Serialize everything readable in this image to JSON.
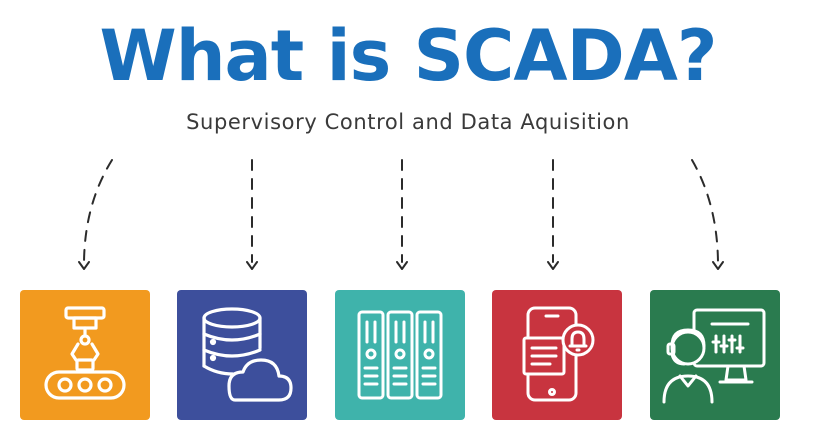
{
  "title": "What is SCADA?",
  "subtitle": "Supervisory Control and Data Aquisition",
  "tiles": [
    {
      "icon": "robotic-arm-conveyor-icon",
      "color": "#f29a1f"
    },
    {
      "icon": "database-cloud-icon",
      "color": "#3d4f9c"
    },
    {
      "icon": "server-racks-icon",
      "color": "#3fb3ab"
    },
    {
      "icon": "smartphone-alert-icon",
      "color": "#c8343f"
    },
    {
      "icon": "operator-monitor-icon",
      "color": "#2a7b4f"
    }
  ]
}
